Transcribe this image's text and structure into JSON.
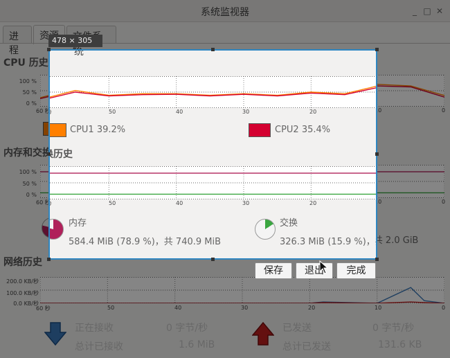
{
  "window": {
    "title": "系统监视器"
  },
  "tabs": [
    {
      "label": "进程"
    },
    {
      "label": "资源"
    },
    {
      "label": "文件系统"
    }
  ],
  "cpu": {
    "title": "CPU 历史",
    "y_ticks": [
      "100 %",
      "50 %",
      "0 %"
    ],
    "x_ticks": [
      "60 秒",
      "50",
      "40",
      "30",
      "20",
      "10",
      "0"
    ],
    "cpu1": {
      "label": "CPU1",
      "value": "39.2%",
      "color": "#ff7f00"
    },
    "cpu2": {
      "label": "CPU2",
      "value": "35.4%",
      "color": "#d40030"
    }
  },
  "memory": {
    "title": "内存和交换历史",
    "y_ticks": [
      "100 %",
      "50 %",
      "0 %"
    ],
    "x_ticks": [
      "60 秒",
      "50",
      "40",
      "30",
      "20",
      "10",
      "0"
    ],
    "mem": {
      "label": "内存",
      "detail": "584.4 MiB (78.9 %)，共 740.9 MiB",
      "percent": 78.9,
      "color": "#b0205a"
    },
    "swap": {
      "label": "交换",
      "detail": "326.3 MiB (15.9 %)，共 2.0 GiB",
      "percent": 15.9,
      "color": "#3aa640"
    }
  },
  "network": {
    "title": "网络历史",
    "y_ticks": [
      "200.0 KB/秒",
      "100.0 KB/秒",
      "0.0 KB/秒"
    ],
    "x_ticks": [
      "60 秒",
      "50",
      "40",
      "30",
      "20",
      "10",
      "0"
    ],
    "recv_label": "正在接收",
    "recv_rate": "0 字节/秒",
    "recv_total_label": "总计已接收",
    "recv_total": "1.6 MiB",
    "sent_label": "已发送",
    "sent_rate": "0 字节/秒",
    "sent_total_label": "总计已发送",
    "sent_total": "131.6 KB"
  },
  "screenshot_tool": {
    "size": "478 × 305",
    "save": "保存",
    "quit": "退出",
    "done": "完成"
  },
  "chart_data": [
    {
      "type": "line",
      "x": [
        60,
        55,
        50,
        45,
        40,
        35,
        30,
        25,
        20,
        15,
        10,
        5,
        0
      ],
      "series": [
        {
          "name": "CPU1",
          "values": [
            28,
            55,
            40,
            45,
            45,
            40,
            45,
            40,
            50,
            45,
            70,
            65,
            35
          ]
        },
        {
          "name": "CPU2",
          "values": [
            25,
            50,
            38,
            42,
            43,
            38,
            43,
            38,
            47,
            42,
            65,
            62,
            30
          ]
        }
      ],
      "ylim": [
        0,
        100
      ]
    },
    {
      "type": "line",
      "x": [
        60,
        0
      ],
      "series": [
        {
          "name": "内存",
          "values": [
            78.9,
            78.9
          ]
        },
        {
          "name": "交换",
          "values": [
            15.9,
            15.9
          ]
        }
      ],
      "ylim": [
        0,
        100
      ]
    },
    {
      "type": "line",
      "x": [
        60,
        20,
        18,
        10,
        5,
        3,
        0
      ],
      "series": [
        {
          "name": "正在接收",
          "values": [
            0,
            0,
            10,
            0,
            120,
            20,
            0
          ]
        },
        {
          "name": "已发送",
          "values": [
            0,
            0,
            5,
            0,
            10,
            5,
            0
          ]
        }
      ],
      "ylim": [
        0,
        200
      ]
    }
  ]
}
